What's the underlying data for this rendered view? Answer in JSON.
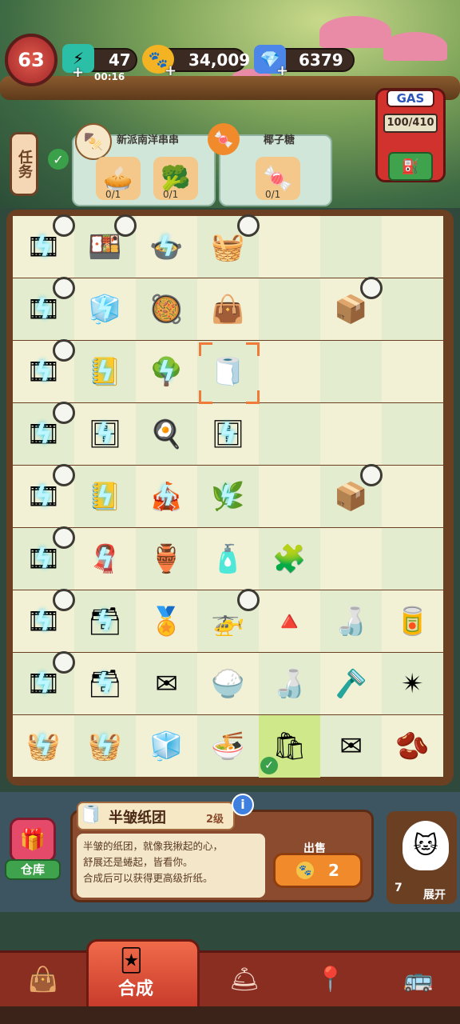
{
  "player": {
    "level": "63"
  },
  "currencies": {
    "energy": {
      "value": "47",
      "timer": "00:16",
      "icon": "lightning-icon"
    },
    "coins": {
      "value": "34,009",
      "icon": "paw-coin-icon"
    },
    "gems": {
      "value": "6379",
      "icon": "gem-icon"
    }
  },
  "quest_tab": {
    "label": "任务",
    "arrow": "⌄"
  },
  "orders": [
    {
      "title": "新派南洋串串",
      "requirements": [
        {
          "count": "0/1"
        },
        {
          "count": "0/1"
        }
      ]
    },
    {
      "title": "椰子糖",
      "requirements": [
        {
          "count": "0/1"
        }
      ]
    }
  ],
  "gas": {
    "label": "GAS",
    "value": "100/410"
  },
  "selected_item": {
    "name": "半皱纸团",
    "grade": "2级",
    "description_line1": "半皱的纸团，就像我揪起的心，",
    "description_line2": "舒展还是蜷起，皆看你。",
    "hint": "合成后可以获得更高级折纸。",
    "sell_label": "出售",
    "sell_price": "2"
  },
  "warehouse": {
    "label": "仓库"
  },
  "expand": {
    "count": "7",
    "label": "展开"
  },
  "nav": {
    "active_label": "合成"
  },
  "board_items": [
    {
      "r": 0,
      "c": 0,
      "e": "🎞",
      "bolt": true,
      "timer": true
    },
    {
      "r": 0,
      "c": 1,
      "e": "🍱",
      "timer": true
    },
    {
      "r": 0,
      "c": 2,
      "e": "🍲",
      "bolt": true
    },
    {
      "r": 0,
      "c": 3,
      "e": "🧺",
      "timer": true
    },
    {
      "r": 1,
      "c": 0,
      "e": "🎞",
      "bolt": true,
      "timer": true
    },
    {
      "r": 1,
      "c": 1,
      "e": "🧊",
      "bolt": true
    },
    {
      "r": 1,
      "c": 2,
      "e": "🥘"
    },
    {
      "r": 1,
      "c": 3,
      "e": "👜"
    },
    {
      "r": 1,
      "c": 5,
      "e": "📦",
      "timer": true
    },
    {
      "r": 2,
      "c": 0,
      "e": "🎞",
      "bolt": true,
      "timer": true
    },
    {
      "r": 2,
      "c": 1,
      "e": "📒",
      "bolt": true
    },
    {
      "r": 2,
      "c": 2,
      "e": "🌳",
      "bolt": true
    },
    {
      "r": 2,
      "c": 3,
      "e": "🧻",
      "selected": true
    },
    {
      "r": 3,
      "c": 0,
      "e": "🎞",
      "bolt": true,
      "timer": true
    },
    {
      "r": 3,
      "c": 1,
      "e": "🗄",
      "bolt": true
    },
    {
      "r": 3,
      "c": 2,
      "e": "🍳"
    },
    {
      "r": 3,
      "c": 3,
      "e": "🗄",
      "bolt": true
    },
    {
      "r": 4,
      "c": 0,
      "e": "🎞",
      "bolt": true,
      "timer": true
    },
    {
      "r": 4,
      "c": 1,
      "e": "📒",
      "bolt": true
    },
    {
      "r": 4,
      "c": 2,
      "e": "🎪",
      "bolt": true
    },
    {
      "r": 4,
      "c": 3,
      "e": "🌿",
      "bolt": true
    },
    {
      "r": 4,
      "c": 5,
      "e": "📦",
      "timer": true
    },
    {
      "r": 5,
      "c": 0,
      "e": "🎞",
      "bolt": true,
      "timer": true
    },
    {
      "r": 5,
      "c": 1,
      "e": "🧣",
      "bolt": true
    },
    {
      "r": 5,
      "c": 2,
      "e": "🏺"
    },
    {
      "r": 5,
      "c": 3,
      "e": "🧴"
    },
    {
      "r": 5,
      "c": 4,
      "e": "🧩"
    },
    {
      "r": 6,
      "c": 0,
      "e": "🎞",
      "bolt": true,
      "timer": true
    },
    {
      "r": 6,
      "c": 1,
      "e": "🗃",
      "bolt": true
    },
    {
      "r": 6,
      "c": 2,
      "e": "🏅"
    },
    {
      "r": 6,
      "c": 3,
      "e": "🚁",
      "timer": true
    },
    {
      "r": 6,
      "c": 4,
      "e": "🔺"
    },
    {
      "r": 6,
      "c": 5,
      "e": "🍶"
    },
    {
      "r": 6,
      "c": 6,
      "e": "🥫"
    },
    {
      "r": 7,
      "c": 0,
      "e": "🎞",
      "bolt": true,
      "timer": true
    },
    {
      "r": 7,
      "c": 1,
      "e": "🗃",
      "bolt": true
    },
    {
      "r": 7,
      "c": 2,
      "e": "✉"
    },
    {
      "r": 7,
      "c": 3,
      "e": "🍚"
    },
    {
      "r": 7,
      "c": 4,
      "e": "🍶"
    },
    {
      "r": 7,
      "c": 5,
      "e": "🪒"
    },
    {
      "r": 7,
      "c": 6,
      "e": "✴"
    },
    {
      "r": 8,
      "c": 0,
      "e": "🧺",
      "bolt": true
    },
    {
      "r": 8,
      "c": 1,
      "e": "🧺",
      "bolt": true
    },
    {
      "r": 8,
      "c": 2,
      "e": "🧊"
    },
    {
      "r": 8,
      "c": 3,
      "e": "🍜"
    },
    {
      "r": 8,
      "c": 4,
      "e": "🛍",
      "check": true
    },
    {
      "r": 8,
      "c": 5,
      "e": "✉"
    },
    {
      "r": 8,
      "c": 6,
      "e": "🫘"
    }
  ]
}
